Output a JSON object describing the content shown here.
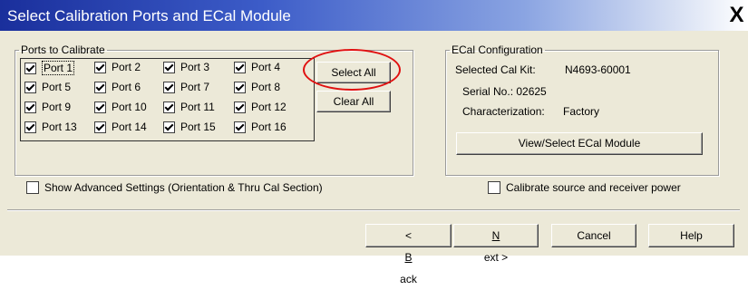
{
  "window": {
    "title": "Select Calibration Ports and ECal Module",
    "close_symbol": "X"
  },
  "ports": {
    "legend": "Ports to Calibrate",
    "items": [
      {
        "label": "Port 1",
        "checked": true
      },
      {
        "label": "Port 2",
        "checked": true
      },
      {
        "label": "Port 3",
        "checked": true
      },
      {
        "label": "Port 4",
        "checked": true
      },
      {
        "label": "Port 5",
        "checked": true
      },
      {
        "label": "Port 6",
        "checked": true
      },
      {
        "label": "Port 7",
        "checked": true
      },
      {
        "label": "Port 8",
        "checked": true
      },
      {
        "label": "Port 9",
        "checked": true
      },
      {
        "label": "Port 10",
        "checked": true
      },
      {
        "label": "Port 11",
        "checked": true
      },
      {
        "label": "Port 12",
        "checked": true
      },
      {
        "label": "Port 13",
        "checked": true
      },
      {
        "label": "Port 14",
        "checked": true
      },
      {
        "label": "Port 15",
        "checked": true
      },
      {
        "label": "Port 16",
        "checked": true
      }
    ],
    "select_all": "Select All",
    "clear_all": "Clear All"
  },
  "ecal": {
    "legend": "ECal Configuration",
    "cal_kit_label": "Selected Cal Kit:",
    "cal_kit_value": "N4693-60001",
    "serial_label": "Serial No.: 02625",
    "characterization_label": "Characterization:",
    "characterization_value": "Factory",
    "view_select_button": "View/Select ECal Module"
  },
  "options": {
    "advanced_settings": {
      "label": "Show Advanced Settings (Orientation & Thru Cal Section)",
      "checked": false
    },
    "calibrate_power": {
      "label": "Calibrate source and receiver power",
      "checked": false
    }
  },
  "footer": {
    "back_prefix": "< ",
    "back_mnemonic": "B",
    "back_rest": "ack",
    "next_mnemonic": "N",
    "next_rest": "ext >",
    "cancel": "Cancel",
    "help": "Help"
  },
  "colors": {
    "dialog_bg": "#ece9d8",
    "title_start": "#1a2f9c",
    "title_end": "#ffffff",
    "highlight_ellipse": "#e01010"
  }
}
